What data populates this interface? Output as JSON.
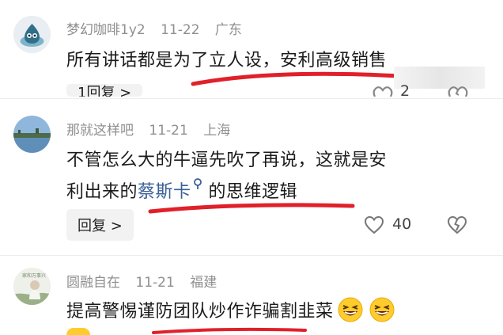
{
  "comments": [
    {
      "username": "梦幻咖啡1y2",
      "date": "11-22",
      "location": "广东",
      "text_lines": [
        "所有讲话都是为了立人设，安利高级销售"
      ],
      "reply_label": "1回复 >",
      "like_count": "2"
    },
    {
      "username": "那就这样吧",
      "date": "11-21",
      "location": "上海",
      "text_lines": [
        "不管怎么大的牛逼先吹了再说，这就是安"
      ],
      "text_line2_prefix": "利出来的",
      "text_line2_link": "蔡斯卡",
      "text_line2_suffix": "的思维逻辑",
      "reply_label": "回复 >",
      "like_count": "40"
    },
    {
      "username": "圆融自在",
      "date": "11-21",
      "location": "福建",
      "text_lines": [
        "提高警惕谨防团队炒作诈骗割韭菜"
      ],
      "avatar_caption": "家和万事兴"
    }
  ],
  "icons": [
    "avatar-water-drop",
    "avatar-lake",
    "avatar-person",
    "search-icon",
    "heart-icon",
    "broken-heart-icon",
    "laughing-emoji-icon"
  ],
  "colors": {
    "link": "#3a5f99",
    "annotation_red": "#e0202a",
    "meta_gray": "#8f8f8f",
    "button_bg": "#f2f2f2"
  }
}
